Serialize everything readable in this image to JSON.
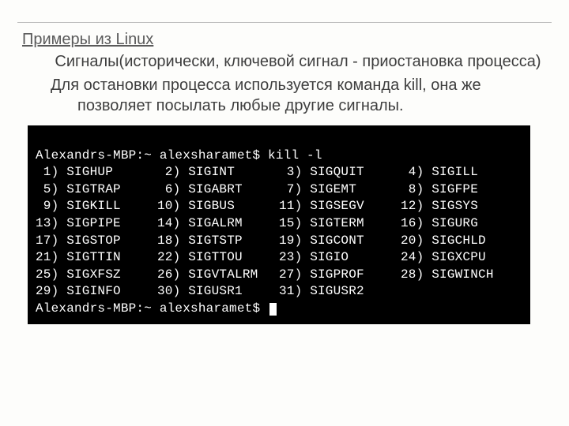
{
  "heading": "Примеры из Linux",
  "sub1": "Сигналы(исторически, ключевой сигнал - приостановка процесса)",
  "sub2": "Для остановки процесса используется команда kill, она же позволяет посылать любые другие сигналы.",
  "terminal": {
    "prompt1": "Alexandrs-MBP:~ alexsharamet$ kill -l",
    "prompt2": "Alexandrs-MBP:~ alexsharamet$ ",
    "signals": [
      {
        "n": 1,
        "name": "SIGHUP"
      },
      {
        "n": 2,
        "name": "SIGINT"
      },
      {
        "n": 3,
        "name": "SIGQUIT"
      },
      {
        "n": 4,
        "name": "SIGILL"
      },
      {
        "n": 5,
        "name": "SIGTRAP"
      },
      {
        "n": 6,
        "name": "SIGABRT"
      },
      {
        "n": 7,
        "name": "SIGEMT"
      },
      {
        "n": 8,
        "name": "SIGFPE"
      },
      {
        "n": 9,
        "name": "SIGKILL"
      },
      {
        "n": 10,
        "name": "SIGBUS"
      },
      {
        "n": 11,
        "name": "SIGSEGV"
      },
      {
        "n": 12,
        "name": "SIGSYS"
      },
      {
        "n": 13,
        "name": "SIGPIPE"
      },
      {
        "n": 14,
        "name": "SIGALRM"
      },
      {
        "n": 15,
        "name": "SIGTERM"
      },
      {
        "n": 16,
        "name": "SIGURG"
      },
      {
        "n": 17,
        "name": "SIGSTOP"
      },
      {
        "n": 18,
        "name": "SIGTSTP"
      },
      {
        "n": 19,
        "name": "SIGCONT"
      },
      {
        "n": 20,
        "name": "SIGCHLD"
      },
      {
        "n": 21,
        "name": "SIGTTIN"
      },
      {
        "n": 22,
        "name": "SIGTTOU"
      },
      {
        "n": 23,
        "name": "SIGIO"
      },
      {
        "n": 24,
        "name": "SIGXCPU"
      },
      {
        "n": 25,
        "name": "SIGXFSZ"
      },
      {
        "n": 26,
        "name": "SIGVTALRM"
      },
      {
        "n": 27,
        "name": "SIGPROF"
      },
      {
        "n": 28,
        "name": "SIGWINCH"
      },
      {
        "n": 29,
        "name": "SIGINFO"
      },
      {
        "n": 30,
        "name": "SIGUSR1"
      },
      {
        "n": 31,
        "name": "SIGUSR2"
      }
    ]
  }
}
